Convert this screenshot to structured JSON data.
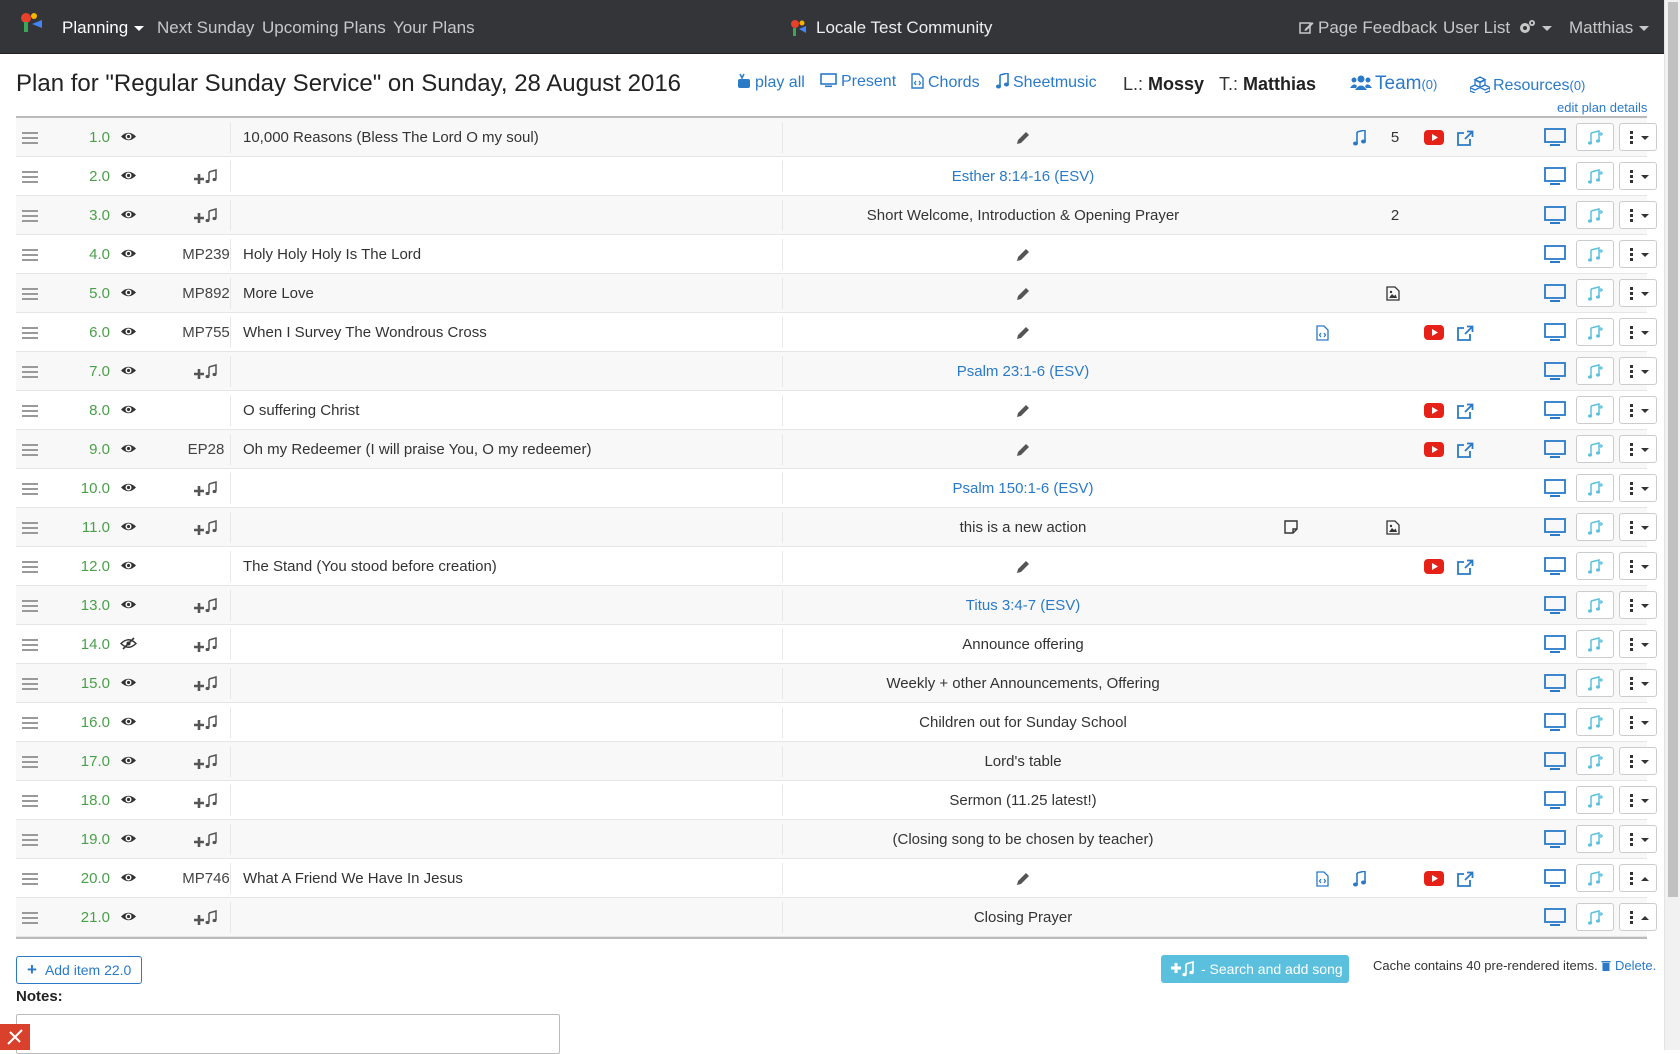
{
  "navbar": {
    "items": [
      "Planning",
      "Next Sunday",
      "Upcoming Plans",
      "Your Plans"
    ],
    "brand": "Locale Test Community",
    "right": [
      "Page Feedback",
      "User List",
      "Matthias"
    ]
  },
  "header": {
    "title": "Plan for \"Regular Sunday Service\" on Sunday, 28 August 2016",
    "links": [
      "play all",
      "Present",
      "Chords",
      "Sheetmusic"
    ],
    "leader_prefix": "L.:",
    "leader": "Mossy",
    "teacher_prefix": "T.:",
    "teacher": "Matthias",
    "team_label": "Team",
    "team_count": "(0)",
    "resources_label": "Resources",
    "resources_count": "(0)",
    "edit_details": "edit plan details"
  },
  "items": [
    {
      "seq": "1.0",
      "visible": true,
      "code": "",
      "add_song": false,
      "title": "10,000 Reasons (Bless The Lord O my soul)",
      "comment": "",
      "comment_link": false,
      "pencil": true,
      "chords": false,
      "music": true,
      "count": "5",
      "image": false,
      "note": false,
      "youtube": true,
      "ext": true,
      "caret_up": false
    },
    {
      "seq": "2.0",
      "visible": true,
      "code": "",
      "add_song": true,
      "title": "",
      "comment": "Esther 8:14-16 (ESV)",
      "comment_link": true,
      "pencil": false,
      "chords": false,
      "music": false,
      "count": "",
      "image": false,
      "note": false,
      "youtube": false,
      "ext": false,
      "caret_up": false
    },
    {
      "seq": "3.0",
      "visible": true,
      "code": "",
      "add_song": true,
      "title": "",
      "comment": "Short Welcome, Introduction & Opening Prayer",
      "comment_link": false,
      "pencil": false,
      "chords": false,
      "music": false,
      "count": "2",
      "image": false,
      "note": false,
      "youtube": false,
      "ext": false,
      "caret_up": false
    },
    {
      "seq": "4.0",
      "visible": true,
      "code": "MP239",
      "add_song": false,
      "title": "Holy Holy Holy Is The Lord",
      "comment": "",
      "comment_link": false,
      "pencil": true,
      "chords": false,
      "music": false,
      "count": "",
      "image": false,
      "note": false,
      "youtube": false,
      "ext": false,
      "caret_up": false
    },
    {
      "seq": "5.0",
      "visible": true,
      "code": "MP892",
      "add_song": false,
      "title": "More Love",
      "comment": "",
      "comment_link": false,
      "pencil": true,
      "chords": false,
      "music": false,
      "count": "",
      "image": true,
      "note": false,
      "youtube": false,
      "ext": false,
      "caret_up": false
    },
    {
      "seq": "6.0",
      "visible": true,
      "code": "MP755",
      "add_song": false,
      "title": "When I Survey The Wondrous Cross",
      "comment": "",
      "comment_link": false,
      "pencil": true,
      "chords": true,
      "music": false,
      "count": "",
      "image": false,
      "note": false,
      "youtube": true,
      "ext": true,
      "caret_up": false
    },
    {
      "seq": "7.0",
      "visible": true,
      "code": "",
      "add_song": true,
      "title": "",
      "comment": "Psalm 23:1-6 (ESV)",
      "comment_link": true,
      "pencil": false,
      "chords": false,
      "music": false,
      "count": "",
      "image": false,
      "note": false,
      "youtube": false,
      "ext": false,
      "caret_up": false
    },
    {
      "seq": "8.0",
      "visible": true,
      "code": "",
      "add_song": false,
      "title": "O suffering Christ",
      "comment": "",
      "comment_link": false,
      "pencil": true,
      "chords": false,
      "music": false,
      "count": "",
      "image": false,
      "note": false,
      "youtube": true,
      "ext": true,
      "caret_up": false
    },
    {
      "seq": "9.0",
      "visible": true,
      "code": "EP28",
      "add_song": false,
      "title": "Oh my Redeemer (I will praise You, O my redeemer)",
      "comment": "",
      "comment_link": false,
      "pencil": true,
      "chords": false,
      "music": false,
      "count": "",
      "image": false,
      "note": false,
      "youtube": true,
      "ext": true,
      "caret_up": false
    },
    {
      "seq": "10.0",
      "visible": true,
      "code": "",
      "add_song": true,
      "title": "",
      "comment": "Psalm 150:1-6 (ESV)",
      "comment_link": true,
      "pencil": false,
      "chords": false,
      "music": false,
      "count": "",
      "image": false,
      "note": false,
      "youtube": false,
      "ext": false,
      "caret_up": false
    },
    {
      "seq": "11.0",
      "visible": true,
      "code": "",
      "add_song": true,
      "title": "",
      "comment": "this is a new action",
      "comment_link": false,
      "pencil": false,
      "chords": false,
      "music": false,
      "count": "",
      "image": true,
      "note": true,
      "youtube": false,
      "ext": false,
      "caret_up": false
    },
    {
      "seq": "12.0",
      "visible": true,
      "code": "",
      "add_song": false,
      "title": "The Stand (You stood before creation)",
      "comment": "",
      "comment_link": false,
      "pencil": true,
      "chords": false,
      "music": false,
      "count": "",
      "image": false,
      "note": false,
      "youtube": true,
      "ext": true,
      "caret_up": false
    },
    {
      "seq": "13.0",
      "visible": true,
      "code": "",
      "add_song": true,
      "title": "",
      "comment": "Titus 3:4-7 (ESV)",
      "comment_link": true,
      "pencil": false,
      "chords": false,
      "music": false,
      "count": "",
      "image": false,
      "note": false,
      "youtube": false,
      "ext": false,
      "caret_up": false
    },
    {
      "seq": "14.0",
      "visible": false,
      "code": "",
      "add_song": true,
      "title": "",
      "comment": "Announce offering",
      "comment_link": false,
      "pencil": false,
      "chords": false,
      "music": false,
      "count": "",
      "image": false,
      "note": false,
      "youtube": false,
      "ext": false,
      "caret_up": false
    },
    {
      "seq": "15.0",
      "visible": true,
      "code": "",
      "add_song": true,
      "title": "",
      "comment": "Weekly + other Announcements, Offering",
      "comment_link": false,
      "pencil": false,
      "chords": false,
      "music": false,
      "count": "",
      "image": false,
      "note": false,
      "youtube": false,
      "ext": false,
      "caret_up": false
    },
    {
      "seq": "16.0",
      "visible": true,
      "code": "",
      "add_song": true,
      "title": "",
      "comment": "Children out for Sunday School",
      "comment_link": false,
      "pencil": false,
      "chords": false,
      "music": false,
      "count": "",
      "image": false,
      "note": false,
      "youtube": false,
      "ext": false,
      "caret_up": false
    },
    {
      "seq": "17.0",
      "visible": true,
      "code": "",
      "add_song": true,
      "title": "",
      "comment": "Lord's table",
      "comment_link": false,
      "pencil": false,
      "chords": false,
      "music": false,
      "count": "",
      "image": false,
      "note": false,
      "youtube": false,
      "ext": false,
      "caret_up": false
    },
    {
      "seq": "18.0",
      "visible": true,
      "code": "",
      "add_song": true,
      "title": "",
      "comment": "Sermon (11.25 latest!)",
      "comment_link": false,
      "pencil": false,
      "chords": false,
      "music": false,
      "count": "",
      "image": false,
      "note": false,
      "youtube": false,
      "ext": false,
      "caret_up": false
    },
    {
      "seq": "19.0",
      "visible": true,
      "code": "",
      "add_song": true,
      "title": "",
      "comment": "(Closing song to be chosen by teacher)",
      "comment_link": false,
      "pencil": false,
      "chords": false,
      "music": false,
      "count": "",
      "image": false,
      "note": false,
      "youtube": false,
      "ext": false,
      "caret_up": false
    },
    {
      "seq": "20.0",
      "visible": true,
      "code": "MP746",
      "add_song": false,
      "title": "What A Friend We Have In Jesus",
      "comment": "",
      "comment_link": false,
      "pencil": true,
      "chords": true,
      "music": true,
      "count": "",
      "image": false,
      "note": false,
      "youtube": true,
      "ext": true,
      "caret_up": true
    },
    {
      "seq": "21.0",
      "visible": true,
      "code": "",
      "add_song": true,
      "title": "",
      "comment": "Closing Prayer",
      "comment_link": false,
      "pencil": false,
      "chords": false,
      "music": false,
      "count": "",
      "image": false,
      "note": false,
      "youtube": false,
      "ext": false,
      "caret_up": true
    }
  ],
  "footer": {
    "add_item": "Add item 22.0",
    "search_song": "- Search and add song",
    "cache_text": "Cache contains 40 pre-rendered items.",
    "delete_label": "Delete.",
    "notes_label": "Notes:"
  },
  "colors": {
    "navbar_bg": "#333539",
    "link_blue": "#2a7ac8",
    "seq_green": "#4aa04a",
    "youtube_red": "#e62117",
    "info_button": "#5bc0de"
  }
}
